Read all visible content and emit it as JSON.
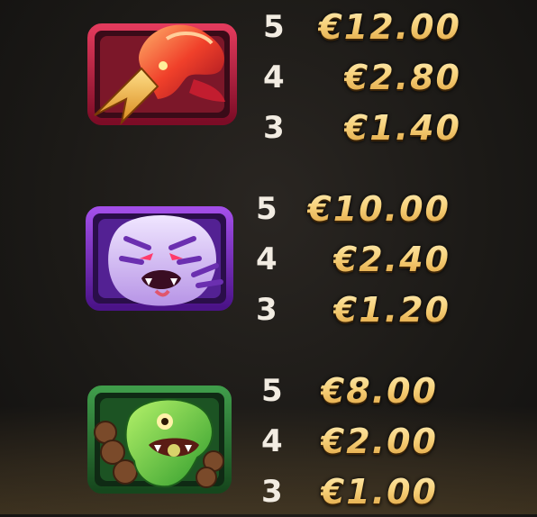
{
  "paytable": {
    "groups": [
      {
        "symbol": "phoenix-icon",
        "frame_color": "#b5173a",
        "payouts": [
          {
            "count": "5",
            "value": "€12.00"
          },
          {
            "count": "4",
            "value": "€2.80"
          },
          {
            "count": "3",
            "value": "€1.40"
          }
        ]
      },
      {
        "symbol": "tiger-icon",
        "frame_color": "#7a2fc4",
        "payouts": [
          {
            "count": "5",
            "value": "€10.00"
          },
          {
            "count": "4",
            "value": "€2.40"
          },
          {
            "count": "3",
            "value": "€1.20"
          }
        ]
      },
      {
        "symbol": "serpent-icon",
        "frame_color": "#2f7a38",
        "payouts": [
          {
            "count": "5",
            "value": "€8.00"
          },
          {
            "count": "4",
            "value": "€2.00"
          },
          {
            "count": "3",
            "value": "€1.00"
          }
        ]
      }
    ]
  }
}
